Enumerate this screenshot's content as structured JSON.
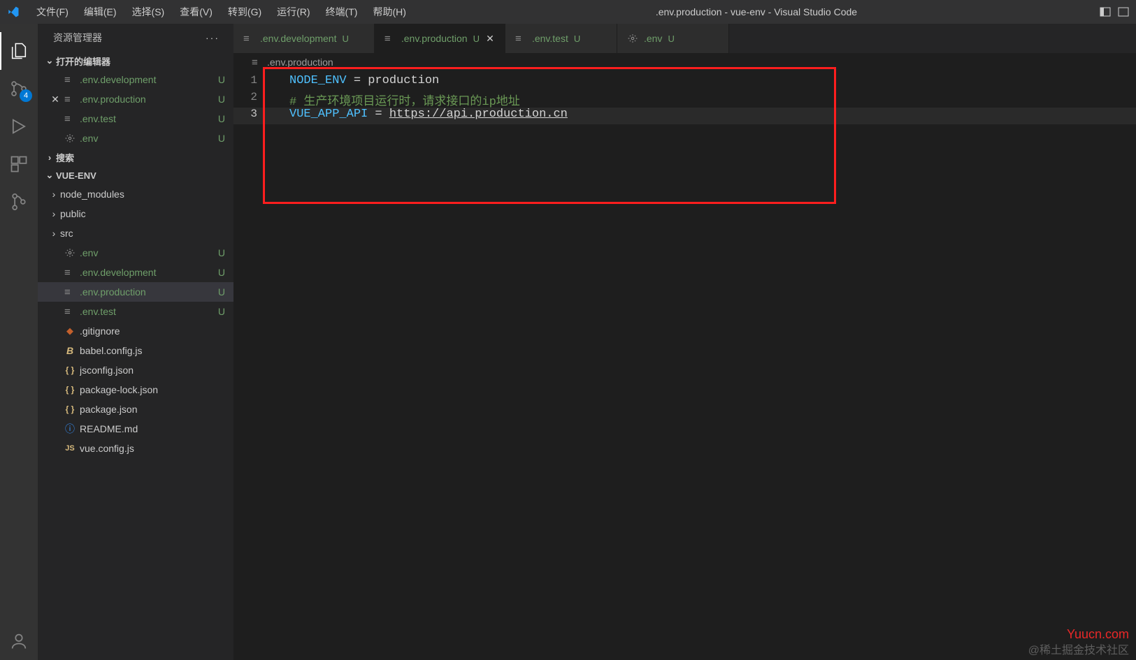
{
  "menu": {
    "items": [
      "文件(F)",
      "编辑(E)",
      "选择(S)",
      "查看(V)",
      "转到(G)",
      "运行(R)",
      "终端(T)",
      "帮助(H)"
    ]
  },
  "title": ".env.production - vue-env - Visual Studio Code",
  "activitybar": {
    "scm_badge": "4"
  },
  "sidebar": {
    "header": "资源管理器",
    "open_editors_title": "打开的编辑器",
    "open_editors": [
      {
        "name": ".env.development",
        "status": "U"
      },
      {
        "name": ".env.production",
        "status": "U",
        "active": true
      },
      {
        "name": ".env.test",
        "status": "U"
      },
      {
        "name": ".env",
        "status": "U",
        "gear": true
      }
    ],
    "search_title": "搜索",
    "project_title": "VUE-ENV",
    "project_entries": [
      {
        "type": "folder",
        "name": "node_modules"
      },
      {
        "type": "folder",
        "name": "public"
      },
      {
        "type": "folder",
        "name": "src"
      },
      {
        "type": "file",
        "name": ".env",
        "icon": "gear",
        "status": "U",
        "untracked": true
      },
      {
        "type": "file",
        "name": ".env.development",
        "icon": "env",
        "status": "U",
        "untracked": true
      },
      {
        "type": "file",
        "name": ".env.production",
        "icon": "env",
        "status": "U",
        "untracked": true,
        "selected": true
      },
      {
        "type": "file",
        "name": ".env.test",
        "icon": "env",
        "status": "U",
        "untracked": true
      },
      {
        "type": "file",
        "name": ".gitignore",
        "icon": "gitignore"
      },
      {
        "type": "file",
        "name": "babel.config.js",
        "icon": "babel"
      },
      {
        "type": "file",
        "name": "jsconfig.json",
        "icon": "json"
      },
      {
        "type": "file",
        "name": "package-lock.json",
        "icon": "json"
      },
      {
        "type": "file",
        "name": "package.json",
        "icon": "json"
      },
      {
        "type": "file",
        "name": "README.md",
        "icon": "info"
      },
      {
        "type": "file",
        "name": "vue.config.js",
        "icon": "js"
      }
    ]
  },
  "tabs": [
    {
      "name": ".env.development",
      "status": "U"
    },
    {
      "name": ".env.production",
      "status": "U",
      "active": true
    },
    {
      "name": ".env.test",
      "status": "U"
    },
    {
      "name": ".env",
      "status": "U",
      "gear": true
    }
  ],
  "breadcrumb": ".env.production",
  "code_lines": [
    {
      "n": "1",
      "segments": [
        {
          "t": "NODE_ENV",
          "c": "tok-var"
        },
        {
          "t": " = ",
          "c": "tok-def"
        },
        {
          "t": "production",
          "c": "tok-def"
        }
      ]
    },
    {
      "n": "2",
      "segments": [
        {
          "t": "# 生产环境项目运行时，请求接口的ip地址",
          "c": "tok-comment"
        }
      ]
    },
    {
      "n": "3",
      "cursor": true,
      "segments": [
        {
          "t": "VUE_APP_API",
          "c": "tok-var"
        },
        {
          "t": " = ",
          "c": "tok-def"
        },
        {
          "t": "https://api.production.cn",
          "c": "tok-def underline"
        }
      ]
    }
  ],
  "watermark_red": "Yuucn.com",
  "watermark_gray": "@稀土掘金技术社区"
}
